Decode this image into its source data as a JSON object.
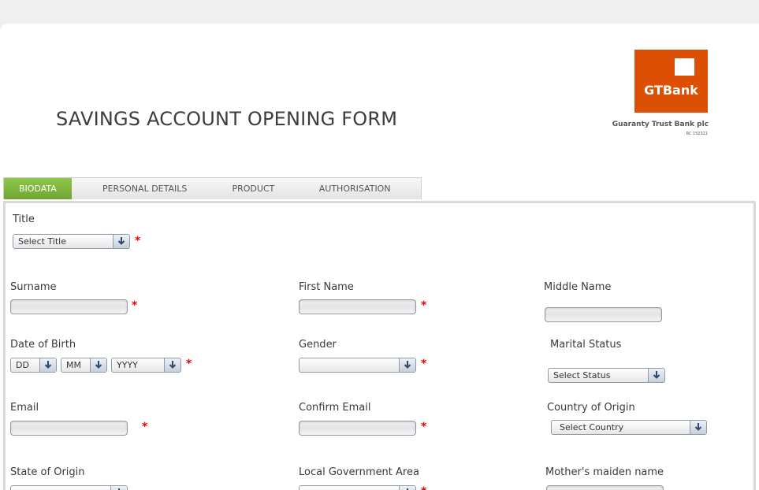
{
  "form": {
    "title": "SAVINGS ACCOUNT OPENING FORM"
  },
  "logo": {
    "brand": "GTBank",
    "caption": "Guaranty Trust Bank plc",
    "rc": "RC 152321",
    "color": "#dd4f05"
  },
  "tabs": [
    {
      "label": "BIODATA",
      "active": true
    },
    {
      "label": "PERSONAL DETAILS",
      "active": false
    },
    {
      "label": "PRODUCT",
      "active": false
    },
    {
      "label": "AUTHORISATION",
      "active": false
    }
  ],
  "fields": {
    "title": {
      "label": "Title",
      "selected": "Select Title"
    },
    "surname": {
      "label": "Surname",
      "value": ""
    },
    "first_name": {
      "label": "First Name",
      "value": ""
    },
    "middle_name": {
      "label": "Middle Name",
      "value": ""
    },
    "dob": {
      "label": "Date of Birth",
      "day": "DD",
      "month": "MM",
      "year": "YYYY"
    },
    "gender": {
      "label": "Gender",
      "selected": ""
    },
    "marital_status": {
      "label": "Marital Status",
      "selected": "Select Status"
    },
    "email": {
      "label": "Email",
      "value": ""
    },
    "confirm_email": {
      "label": "Confirm Email",
      "value": ""
    },
    "country_of_origin": {
      "label": "Country of Origin",
      "selected": "Select Country"
    },
    "state_of_origin": {
      "label": "State of Origin",
      "selected": ""
    },
    "lga": {
      "label": "Local Government Area",
      "selected": ""
    },
    "mothers_maiden_name": {
      "label": "Mother's maiden name",
      "value": ""
    }
  },
  "required_marker": "*",
  "colors": {
    "accent_green": "#7ab53c",
    "required_red": "#ee0000"
  }
}
